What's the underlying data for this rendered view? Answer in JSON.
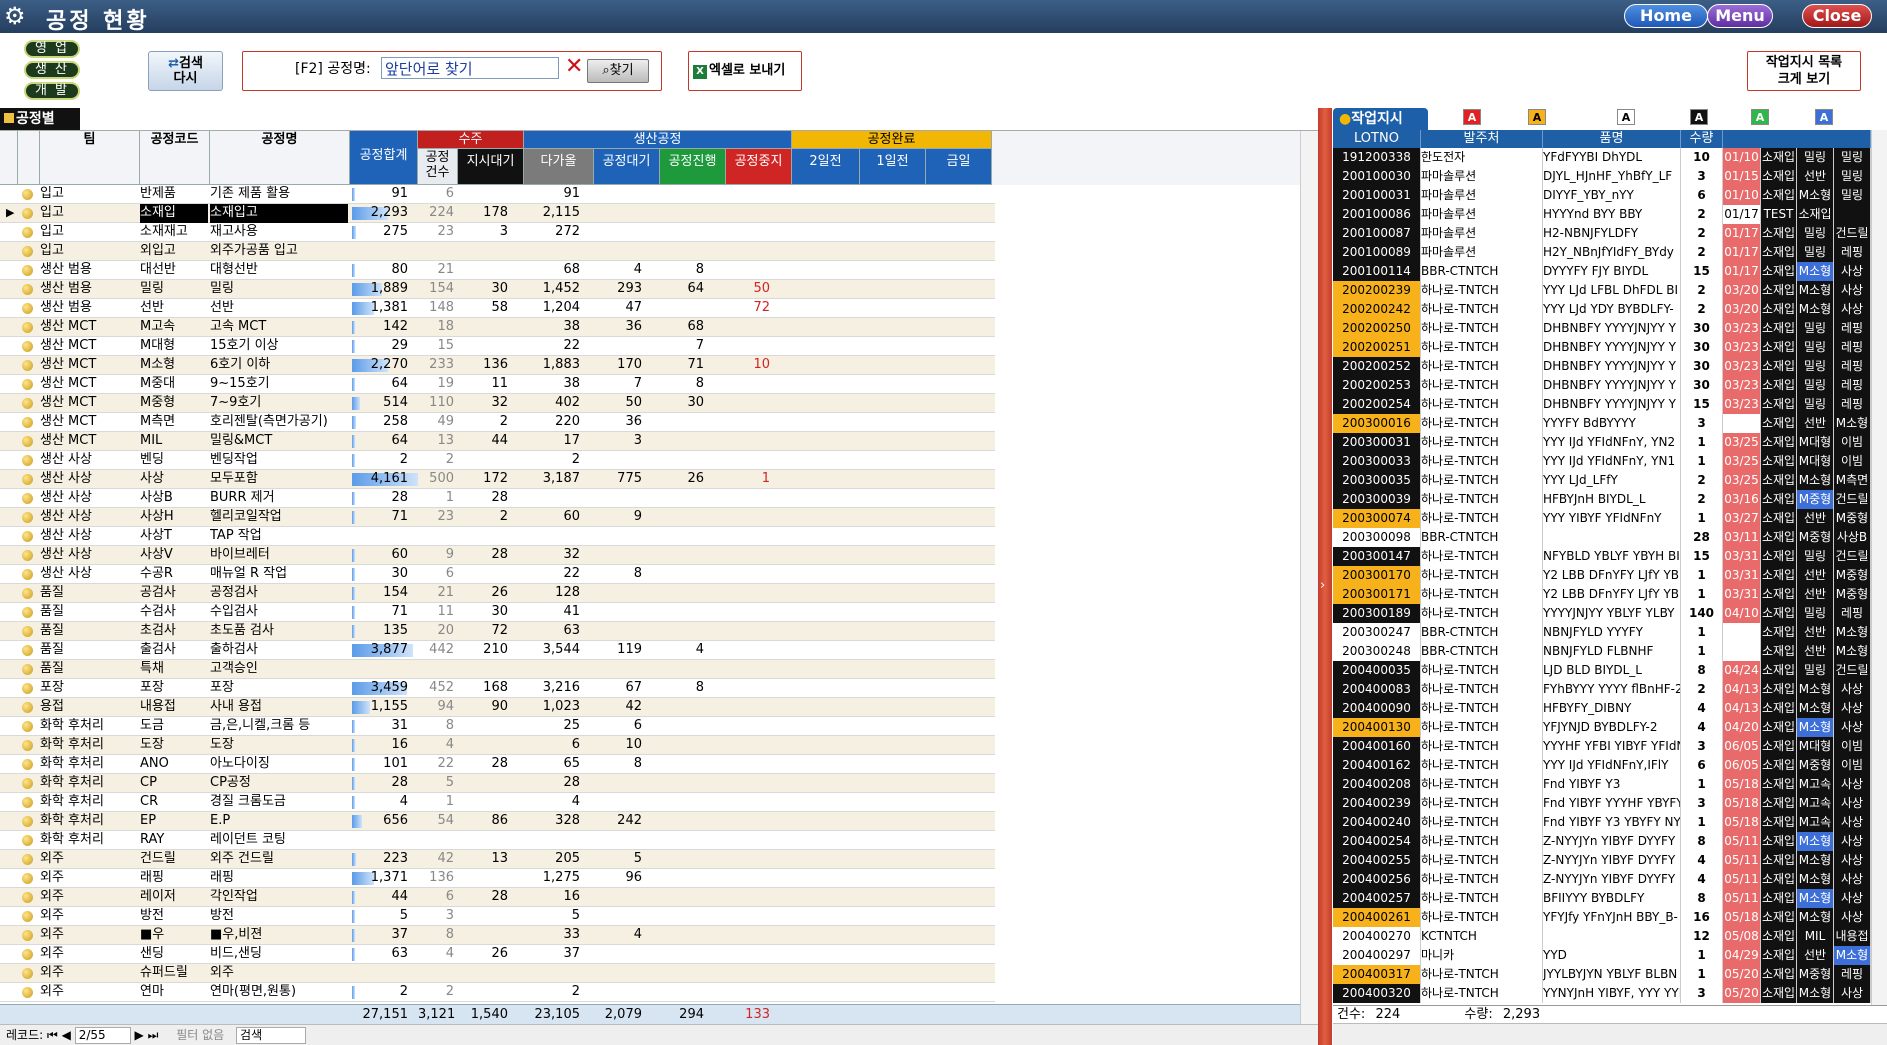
{
  "window": {
    "title": "공정 현황",
    "home": "Home",
    "menu": "Menu",
    "close": "Close"
  },
  "toolbar": {
    "dept_sales": "영업",
    "dept_prod": "생산",
    "dept_dev": "개발",
    "search_again_1": "검색",
    "search_again_2": "다시",
    "search_label": "[F2] 공정명:",
    "search_value": "앞단어로 찾기",
    "find": "찾기",
    "excel": "엑셀로 보내기",
    "big_view_1": "작업지시 목록",
    "big_view_2": "크게 보기"
  },
  "left": {
    "tab": "공정별",
    "headers": {
      "team": "팀",
      "code": "공정코드",
      "name": "공정명",
      "total": "공정합계",
      "order": "수주",
      "order_cnt1": "공정",
      "order_cnt2": "건수",
      "order_wait": "지시대기",
      "prod": "생산공정",
      "prod_a": "다가올",
      "prod_b": "공정대기",
      "prod_c": "공정진행",
      "prod_d": "공정중지",
      "done": "공정완료",
      "done_a": "2일전",
      "done_b": "1일전",
      "done_c": "금일"
    },
    "rows": [
      [
        "입고",
        "반제품",
        "기존 제품 활용",
        "91",
        "6",
        "",
        "91",
        "",
        "",
        "",
        ""
      ],
      [
        "입고",
        "소재입",
        "소재입고",
        "2,293",
        "224",
        "178",
        "2,115",
        "",
        "",
        "",
        ""
      ],
      [
        "입고",
        "소재재고",
        "재고사용",
        "275",
        "23",
        "3",
        "272",
        "",
        "",
        "",
        ""
      ],
      [
        "입고",
        "외입고",
        "외주가공품 입고",
        "",
        "",
        "",
        "",
        "",
        "",
        "",
        ""
      ],
      [
        "생산 범용",
        "대선반",
        "대형선반",
        "80",
        "21",
        "",
        "68",
        "4",
        "8",
        "",
        ""
      ],
      [
        "생산 범용",
        "밀링",
        "밀링",
        "1,889",
        "154",
        "30",
        "1,452",
        "293",
        "64",
        "50",
        ""
      ],
      [
        "생산 범용",
        "선반",
        "선반",
        "1,381",
        "148",
        "58",
        "1,204",
        "47",
        "",
        "72",
        ""
      ],
      [
        "생산 MCT",
        "M고속",
        "고속 MCT",
        "142",
        "18",
        "",
        "38",
        "36",
        "68",
        "",
        ""
      ],
      [
        "생산 MCT",
        "M대형",
        "15호기 이상",
        "29",
        "15",
        "",
        "22",
        "",
        "7",
        "",
        ""
      ],
      [
        "생산 MCT",
        "M소형",
        "6호기 이하",
        "2,270",
        "233",
        "136",
        "1,883",
        "170",
        "71",
        "10",
        ""
      ],
      [
        "생산 MCT",
        "M중대",
        "9~15호기",
        "64",
        "19",
        "11",
        "38",
        "7",
        "8",
        "",
        ""
      ],
      [
        "생산 MCT",
        "M중형",
        "7~9호기",
        "514",
        "110",
        "32",
        "402",
        "50",
        "30",
        "",
        ""
      ],
      [
        "생산 MCT",
        "M측면",
        "호리젠탈(측면가공기)",
        "258",
        "49",
        "2",
        "220",
        "36",
        "",
        "",
        ""
      ],
      [
        "생산 MCT",
        "MIL",
        "밀링&MCT",
        "64",
        "13",
        "44",
        "17",
        "3",
        "",
        "",
        ""
      ],
      [
        "생산 사상",
        "벤딩",
        "벤딩작업",
        "2",
        "2",
        "",
        "2",
        "",
        "",
        "",
        ""
      ],
      [
        "생산 사상",
        "사상",
        "모두포함",
        "4,161",
        "500",
        "172",
        "3,187",
        "775",
        "26",
        "1",
        ""
      ],
      [
        "생산 사상",
        "사상B",
        "BURR 제거",
        "28",
        "1",
        "28",
        "",
        "",
        "",
        "",
        ""
      ],
      [
        "생산 사상",
        "사상H",
        "헬리코일작업",
        "71",
        "23",
        "2",
        "60",
        "9",
        "",
        "",
        ""
      ],
      [
        "생산 사상",
        "사상T",
        "TAP 작업",
        "",
        "",
        "",
        "",
        "",
        "",
        "",
        ""
      ],
      [
        "생산 사상",
        "사상V",
        "바이브레터",
        "60",
        "9",
        "28",
        "32",
        "",
        "",
        "",
        ""
      ],
      [
        "생산 사상",
        "수공R",
        "매뉴얼 R 작업",
        "30",
        "6",
        "",
        "22",
        "8",
        "",
        "",
        ""
      ],
      [
        "품질",
        "공검사",
        "공정검사",
        "154",
        "21",
        "26",
        "128",
        "",
        "",
        "",
        ""
      ],
      [
        "품질",
        "수검사",
        "수입검사",
        "71",
        "11",
        "30",
        "41",
        "",
        "",
        "",
        ""
      ],
      [
        "품질",
        "초검사",
        "초도품 검사",
        "135",
        "20",
        "72",
        "63",
        "",
        "",
        "",
        ""
      ],
      [
        "품질",
        "출검사",
        "출하검사",
        "3,877",
        "442",
        "210",
        "3,544",
        "119",
        "4",
        "",
        ""
      ],
      [
        "품질",
        "특채",
        "고객승인",
        "",
        "",
        "",
        "",
        "",
        "",
        "",
        ""
      ],
      [
        "포장",
        "포장",
        "포장",
        "3,459",
        "452",
        "168",
        "3,216",
        "67",
        "8",
        "",
        ""
      ],
      [
        "용접",
        "내용접",
        "사내 용접",
        "1,155",
        "94",
        "90",
        "1,023",
        "42",
        "",
        "",
        ""
      ],
      [
        "화학 후처리",
        "도금",
        "금,은,니켈,크롬 등",
        "31",
        "8",
        "",
        "25",
        "6",
        "",
        "",
        ""
      ],
      [
        "화학 후처리",
        "도장",
        "도장",
        "16",
        "4",
        "",
        "6",
        "10",
        "",
        "",
        ""
      ],
      [
        "화학 후처리",
        "ANO",
        "아노다이징",
        "101",
        "22",
        "28",
        "65",
        "8",
        "",
        "",
        ""
      ],
      [
        "화학 후처리",
        "CP",
        "CP공정",
        "28",
        "5",
        "",
        "28",
        "",
        "",
        "",
        ""
      ],
      [
        "화학 후처리",
        "CR",
        "경질 크롬도금",
        "4",
        "1",
        "",
        "4",
        "",
        "",
        "",
        ""
      ],
      [
        "화학 후처리",
        "EP",
        "E.P",
        "656",
        "54",
        "86",
        "328",
        "242",
        "",
        "",
        ""
      ],
      [
        "화학 후처리",
        "RAY",
        "레이던트 코팅",
        "",
        "",
        "",
        "",
        "",
        "",
        "",
        ""
      ],
      [
        "외주",
        "건드릴",
        "외주 건드릴",
        "223",
        "42",
        "13",
        "205",
        "5",
        "",
        "",
        ""
      ],
      [
        "외주",
        "래핑",
        "래핑",
        "1,371",
        "136",
        "",
        "1,275",
        "96",
        "",
        "",
        ""
      ],
      [
        "외주",
        "레이저",
        "각인작업",
        "44",
        "6",
        "28",
        "16",
        "",
        "",
        "",
        ""
      ],
      [
        "외주",
        "방전",
        "방전",
        "5",
        "3",
        "",
        "5",
        "",
        "",
        "",
        ""
      ],
      [
        "외주",
        "■우",
        "■우,비젼",
        "37",
        "8",
        "",
        "33",
        "4",
        "",
        "",
        ""
      ],
      [
        "외주",
        "샌딩",
        "비드,샌딩",
        "63",
        "4",
        "26",
        "37",
        "",
        "",
        "",
        ""
      ],
      [
        "외주",
        "슈퍼드릴",
        "외주",
        "",
        "",
        "",
        "",
        "",
        "",
        "",
        ""
      ],
      [
        "외주",
        "연마",
        "연마(평면,원통)",
        "2",
        "2",
        "",
        "2",
        "",
        "",
        "",
        ""
      ]
    ],
    "totals": [
      "27,151",
      "3,121",
      "1,540",
      "23,105",
      "2,079",
      "294",
      "133"
    ],
    "nav": {
      "label": "레코드:",
      "pos": "2/55",
      "filter": "필터 없음",
      "search": "검색"
    }
  },
  "right": {
    "tab": "작업지시",
    "legend": [
      "A",
      "A",
      "A",
      "A",
      "A",
      "A"
    ],
    "headers": [
      "LOTNO",
      "발주처",
      "품명",
      "수량"
    ],
    "rows": [
      [
        "191200338",
        "한도전자",
        "YFdFYYBI DhYDL",
        "10",
        "01/10",
        "소재입",
        "밀링",
        "밀링",
        "b"
      ],
      [
        "200100030",
        "파마솔루션",
        "DJYL_HJnHF_YhBfY_LF",
        "3",
        "01/15",
        "소재입",
        "선반",
        "밀링",
        "b"
      ],
      [
        "200100031",
        "파마솔루션",
        "DIYYF_YBY_nYY",
        "6",
        "01/10",
        "소재입",
        "M소형",
        "밀링",
        "b"
      ],
      [
        "200100086",
        "파마솔루션",
        "HYYYnd BYY BBY",
        "2",
        "01/17",
        "TEST",
        "소재입",
        "",
        "b"
      ],
      [
        "200100087",
        "파마솔루션",
        "H2-NBNJFYLDFY",
        "2",
        "01/17",
        "소재입",
        "밀링",
        "건드릴",
        "b"
      ],
      [
        "200100089",
        "파마솔루션",
        "H2Y_NBnJfYIdFY_BYdy",
        "2",
        "01/17",
        "소재입",
        "밀링",
        "레핑",
        "b"
      ],
      [
        "200100114",
        "BBR-CTNTCH",
        "DYYYFY FJY BIYDL",
        "15",
        "01/17",
        "소재입",
        "M소형",
        "사상",
        "b"
      ],
      [
        "200200239",
        "하나로-TNTCH",
        "YYY LJd LFBL DhFDL BI",
        "2",
        "03/20",
        "소재입",
        "M소형",
        "사상",
        "o"
      ],
      [
        "200200242",
        "하나로-TNTCH",
        "YYY LJd YDY BYBDLFY-",
        "2",
        "03/20",
        "소재입",
        "M소형",
        "사상",
        "o"
      ],
      [
        "200200250",
        "하나로-TNTCH",
        "DHBNBFY YYYYJNJYY Y",
        "30",
        "03/23",
        "소재입",
        "밀링",
        "레핑",
        "o"
      ],
      [
        "200200251",
        "하나로-TNTCH",
        "DHBNBFY YYYYJNJYY Y",
        "30",
        "03/23",
        "소재입",
        "밀링",
        "레핑",
        "o"
      ],
      [
        "200200252",
        "하나로-TNTCH",
        "DHBNBFY YYYYJNJYY Y",
        "30",
        "03/23",
        "소재입",
        "밀링",
        "레핑",
        "b"
      ],
      [
        "200200253",
        "하나로-TNTCH",
        "DHBNBFY YYYYJNJYY Y",
        "30",
        "03/23",
        "소재입",
        "밀링",
        "레핑",
        "b"
      ],
      [
        "200200254",
        "하나로-TNTCH",
        "DHBNBFY YYYYJNJYY Y",
        "15",
        "03/23",
        "소재입",
        "밀링",
        "레핑",
        "b"
      ],
      [
        "200300016",
        "하나로-TNTCH",
        "YYYFY BdBYYYY",
        "3",
        "",
        "소재입",
        "선반",
        "M소형",
        "o"
      ],
      [
        "200300031",
        "하나로-TNTCH",
        "YYY IJd YFIdNFnY, YN2",
        "1",
        "03/25",
        "소재입",
        "M대형",
        "이빔",
        "b"
      ],
      [
        "200300033",
        "하나로-TNTCH",
        "YYY IJd YFIdNFnY, YN1",
        "1",
        "03/25",
        "소재입",
        "M대형",
        "이빔",
        "b"
      ],
      [
        "200300035",
        "하나로-TNTCH",
        "YYY LJd_LFfY",
        "2",
        "03/25",
        "소재입",
        "M소형",
        "M측면",
        "b"
      ],
      [
        "200300039",
        "하나로-TNTCH",
        "HFBYJnH BIYDL_L",
        "2",
        "03/16",
        "소재입",
        "M중형",
        "건드릴",
        "b"
      ],
      [
        "200300074",
        "하나로-TNTCH",
        "YYY YIBYF YFIdNFnY",
        "1",
        "03/27",
        "소재입",
        "선반",
        "M중형",
        "o"
      ],
      [
        "200300098",
        "BBR-CTNTCH",
        "",
        "28",
        "03/11",
        "소재입",
        "M중형",
        "사상B",
        "w"
      ],
      [
        "200300147",
        "하나로-TNTCH",
        "NFYBLD YBLYF YBYH BI",
        "15",
        "03/31",
        "소재입",
        "밀링",
        "건드릴",
        "b"
      ],
      [
        "200300170",
        "하나로-TNTCH",
        "Y2 LBB DFnYFY LJfY YB",
        "1",
        "03/31",
        "소재입",
        "선반",
        "M중형",
        "o"
      ],
      [
        "200300171",
        "하나로-TNTCH",
        "Y2 LBB DFnYFY LJfY YB",
        "1",
        "03/31",
        "소재입",
        "선반",
        "M중형",
        "o"
      ],
      [
        "200300189",
        "하나로-TNTCH",
        "YYYYJNJYY YBLYF YLBY",
        "140",
        "04/10",
        "소재입",
        "밀링",
        "레핑",
        "b"
      ],
      [
        "200300247",
        "BBR-CTNTCH",
        "NBNJFYLD YYYFY",
        "1",
        "",
        "소재입",
        "선반",
        "M소형",
        "w"
      ],
      [
        "200300248",
        "BBR-CTNTCH",
        "NBNJFYLD FLBNHF",
        "1",
        "",
        "소재입",
        "선반",
        "M소형",
        "w"
      ],
      [
        "200400035",
        "하나로-TNTCH",
        "LJD BLD BIYDL_L",
        "8",
        "04/24",
        "소재입",
        "밀링",
        "건드릴",
        "b"
      ],
      [
        "200400083",
        "하나로-TNTCH",
        "FYhBYYY YYYY flBnHF-2",
        "2",
        "04/13",
        "소재입",
        "M소형",
        "사상",
        "b"
      ],
      [
        "200400090",
        "하나로-TNTCH",
        "HFBYFY_DIBNY",
        "4",
        "04/13",
        "소재입",
        "M소형",
        "사상",
        "b"
      ],
      [
        "200400130",
        "하나로-TNTCH",
        "YFJYNJD BYBDLFY-2",
        "4",
        "04/20",
        "소재입",
        "M소형",
        "사상",
        "o"
      ],
      [
        "200400160",
        "하나로-TNTCH",
        "YYYHF YFBI YIBYF YFIdN",
        "3",
        "06/05",
        "소재입",
        "M대형",
        "이빔",
        "b"
      ],
      [
        "200400162",
        "하나로-TNTCH",
        "YYY IJd YFIdNFnY,IFlY",
        "6",
        "06/05",
        "소재입",
        "M중형",
        "이빔",
        "b"
      ],
      [
        "200400208",
        "하나로-TNTCH",
        "Fnd YIBYF Y3",
        "1",
        "05/18",
        "소재입",
        "M고속",
        "사상",
        "b"
      ],
      [
        "200400239",
        "하나로-TNTCH",
        "Fnd YIBYF YYYHF YBYFY",
        "3",
        "05/18",
        "소재입",
        "M고속",
        "사상",
        "b"
      ],
      [
        "200400240",
        "하나로-TNTCH",
        "Fnd YIBYF Y3 YBYFY NY",
        "1",
        "05/18",
        "소재입",
        "M고속",
        "사상",
        "b"
      ],
      [
        "200400254",
        "하나로-TNTCH",
        "Z-NYYJYn YIBYF DYYFY",
        "8",
        "05/11",
        "소재입",
        "M소형",
        "사상",
        "b"
      ],
      [
        "200400255",
        "하나로-TNTCH",
        "Z-NYYJYn YIBYF DYYFY",
        "4",
        "05/11",
        "소재입",
        "M소형",
        "사상",
        "b"
      ],
      [
        "200400256",
        "하나로-TNTCH",
        "Z-NYYJYn YIBYF DYYFY",
        "4",
        "05/11",
        "소재입",
        "M소형",
        "사상",
        "b"
      ],
      [
        "200400257",
        "하나로-TNTCH",
        "BFIIYYY BYBDLFY",
        "8",
        "05/11",
        "소재입",
        "M소형",
        "사상",
        "b"
      ],
      [
        "200400261",
        "하나로-TNTCH",
        "YFYJfy YFnYJnH BBY_B-",
        "16",
        "05/18",
        "소재입",
        "M소형",
        "사상",
        "o"
      ],
      [
        "200400270",
        "KCTNTCH",
        "",
        "12",
        "05/08",
        "소재입",
        "MIL",
        "내용접",
        "w"
      ],
      [
        "200400297",
        "마니카",
        "YYD",
        "1",
        "04/29",
        "소재입",
        "선반",
        "M소형",
        "w"
      ],
      [
        "200400317",
        "하나로-TNTCH",
        "JYYLBYJYN YBLYF BLBN",
        "1",
        "05/20",
        "소재입",
        "M중형",
        "레핑",
        "o"
      ],
      [
        "200400320",
        "하나로-TNTCH",
        "YYNYJnH YIBYF, YYY YYI",
        "3",
        "05/20",
        "소재입",
        "M소형",
        "사상",
        "b"
      ]
    ],
    "total_count_label": "건수:",
    "total_count": "224",
    "total_qty_label": "수량:",
    "total_qty": "2,293"
  }
}
